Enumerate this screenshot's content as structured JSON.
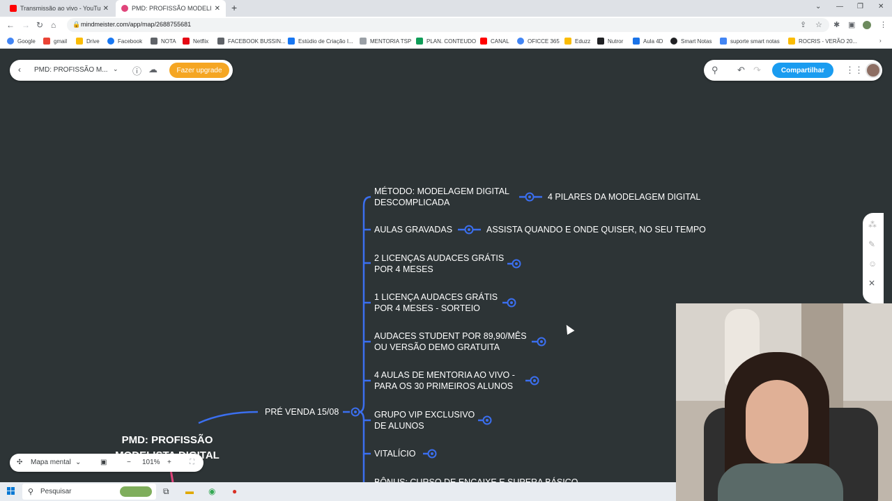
{
  "browser": {
    "tabs": [
      {
        "title": "Transmissão ao vivo - YouTube S",
        "icon": "youtube-icon",
        "color": "#ff0000"
      },
      {
        "title": "PMD: PROFISSÃO MODELISTA DI",
        "icon": "mindmeister-icon",
        "color": "#e0457b"
      }
    ],
    "url": "mindmeister.com/app/map/2688755681"
  },
  "bookmarks": [
    {
      "label": "Google",
      "color": "#4285f4"
    },
    {
      "label": "gmail",
      "color": "#ea4335"
    },
    {
      "label": "Drive",
      "color": "#fbbc04"
    },
    {
      "label": "Facebook",
      "color": "#1877f2"
    },
    {
      "label": "NOTA",
      "color": "#5f6368"
    },
    {
      "label": "Netflix",
      "color": "#e50914"
    },
    {
      "label": "FACEBOOK BUSSIN...",
      "color": "#5f6368"
    },
    {
      "label": "Estúdio de Criação I...",
      "color": "#1877f2"
    },
    {
      "label": "MENTORIA TSP",
      "color": "#9aa0a6"
    },
    {
      "label": "PLAN. CONTEUDO",
      "color": "#0f9d58"
    },
    {
      "label": "CANAL",
      "color": "#ff0000"
    },
    {
      "label": "OFICCE 365",
      "color": "#4285f4"
    },
    {
      "label": "Eduzz",
      "color": "#fbbc04"
    },
    {
      "label": "Nutror",
      "color": "#202124"
    },
    {
      "label": "Aula 4D",
      "color": "#1a73e8"
    },
    {
      "label": "Smart Notas",
      "color": "#202124"
    },
    {
      "label": "suporte smart notas",
      "color": "#4285f4"
    },
    {
      "label": "ROCRIS - VERÃO 20...",
      "color": "#fbbc04"
    }
  ],
  "app": {
    "map_name": "PMD: PROFISSÃO M...",
    "upgrade_label": "Fazer upgrade",
    "share_label": "Compartilhar",
    "view_mode": "Mapa mental",
    "zoom": "101%"
  },
  "mindmap": {
    "root": [
      "PMD: PROFISSÃO",
      "MODELISTA DIGITAL"
    ],
    "branch": "PRÉ VENDA 15/08",
    "children": [
      {
        "lines": [
          "MÉTODO: MODELAGEM DIGITAL",
          "DESCOMPLICADA"
        ],
        "child": "4 PILARES DA MODELAGEM DIGITAL"
      },
      {
        "lines": [
          "AULAS GRAVADAS"
        ],
        "child": "ASSISTA QUANDO E ONDE QUISER, NO SEU TEMPO"
      },
      {
        "lines": [
          "2 LICENÇAS AUDACES GRÁTIS",
          "POR 4 MESES"
        ]
      },
      {
        "lines": [
          "1 LICENÇA AUDACES GRÁTIS",
          "POR 4 MESES - SORTEIO"
        ]
      },
      {
        "lines": [
          "AUDACES STUDENT POR 89,90/MÊS",
          "OU VERSÃO DEMO GRATUITA"
        ]
      },
      {
        "lines": [
          "4 AULAS  DE MENTORIA AO VIVO -",
          "PARA OS 30 PRIMEIROS ALUNOS"
        ]
      },
      {
        "lines": [
          "GRUPO VIP EXCLUSIVO",
          "DE ALUNOS"
        ]
      },
      {
        "lines": [
          "VITALÍCIO"
        ]
      },
      {
        "lines": [
          "BÔNUS: CURSO DE ENCAIXE E SUPERA BÁSICO"
        ]
      }
    ]
  },
  "taskbar": {
    "search_placeholder": "Pesquisar"
  },
  "colors": {
    "canvas": "#2d3436",
    "connector": "#3b6ff0",
    "root_connector": "#e0457b",
    "upgrade": "#f5a623",
    "share": "#1a9cf0"
  }
}
